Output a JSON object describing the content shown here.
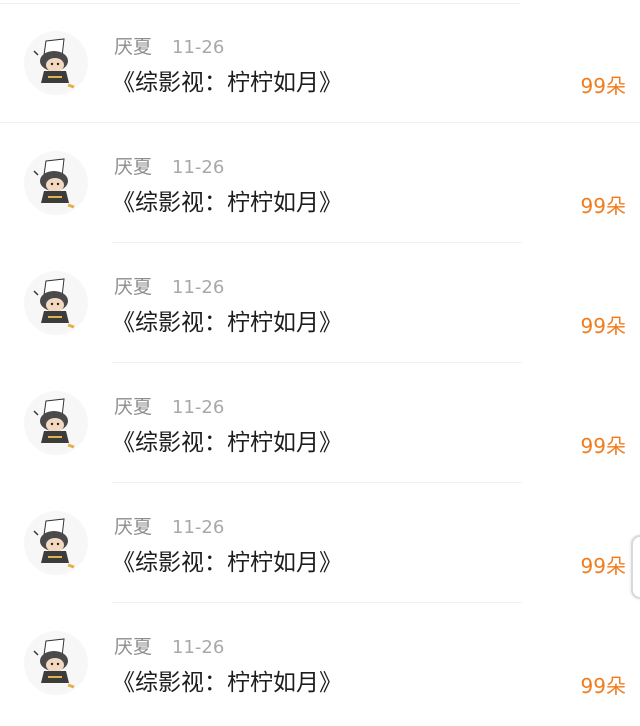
{
  "items": [
    {
      "username": "厌夏",
      "date": "11-26",
      "title": "《综影视：柠柠如月》",
      "flowers": "99朵"
    },
    {
      "username": "厌夏",
      "date": "11-26",
      "title": "《综影视：柠柠如月》",
      "flowers": "99朵"
    },
    {
      "username": "厌夏",
      "date": "11-26",
      "title": "《综影视：柠柠如月》",
      "flowers": "99朵"
    },
    {
      "username": "厌夏",
      "date": "11-26",
      "title": "《综影视：柠柠如月》",
      "flowers": "99朵"
    },
    {
      "username": "厌夏",
      "date": "11-26",
      "title": "《综影视：柠柠如月》",
      "flowers": "99朵"
    },
    {
      "username": "厌夏",
      "date": "11-26",
      "title": "《综影视：柠柠如月》",
      "flowers": "99朵"
    }
  ],
  "colors": {
    "accent": "#f17b1c",
    "username": "#8e8e8e",
    "date": "#a8a8a8",
    "title": "#1d1d1d",
    "divider": "#f1f1f1"
  },
  "icons": {
    "avatar": "chibi-character-avatar-icon"
  }
}
